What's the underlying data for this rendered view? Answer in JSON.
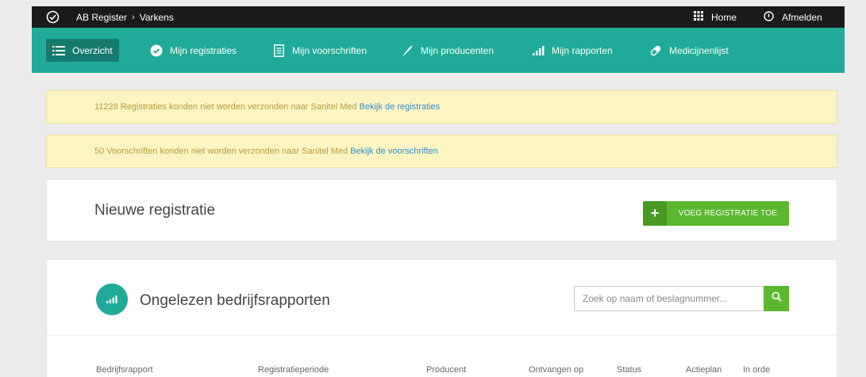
{
  "topbar": {
    "breadcrumb_app": "AB Register",
    "breadcrumb_page": "Varkens",
    "home_label": "Home",
    "logout_label": "Afmelden"
  },
  "nav": {
    "items": [
      {
        "label": "Overzicht",
        "icon": "list-icon",
        "active": true
      },
      {
        "label": "Mijn registraties",
        "icon": "check-circle-icon"
      },
      {
        "label": "Mijn voorschriften",
        "icon": "document-icon"
      },
      {
        "label": "Mijn producenten",
        "icon": "syringe-icon"
      },
      {
        "label": "Mijn rapporten",
        "icon": "bar-chart-icon"
      },
      {
        "label": "Medicijnenlijst",
        "icon": "pill-icon"
      }
    ]
  },
  "alerts": [
    {
      "text": "11228 Registraties konden niet worden verzonden naar Sanitel Med",
      "link": "Bekijk de registraties"
    },
    {
      "text": "50 Voorschriften konden niet worden verzonden naar Sanitel Med",
      "link": "Bekijk de voorschriften"
    }
  ],
  "new_registration": {
    "title": "Nieuwe registratie",
    "button_label": "VOEG REGISTRATIE TOE"
  },
  "reports": {
    "title": "Ongelezen bedrijfsrapporten",
    "search_placeholder": "Zoek op naam of beslagnummer...",
    "columns": [
      "Bedrijfsrapport",
      "Registratieperiode",
      "Producent",
      "Ontvangen op",
      "Status",
      "Actieplan",
      "In orde"
    ]
  },
  "colors": {
    "accent": "#1fab97",
    "accent_dark": "#167a6c",
    "topbar": "#1b1b1b",
    "button_green": "#5ab82f",
    "alert_bg": "#fcf5c2",
    "link": "#2f8ed0"
  }
}
